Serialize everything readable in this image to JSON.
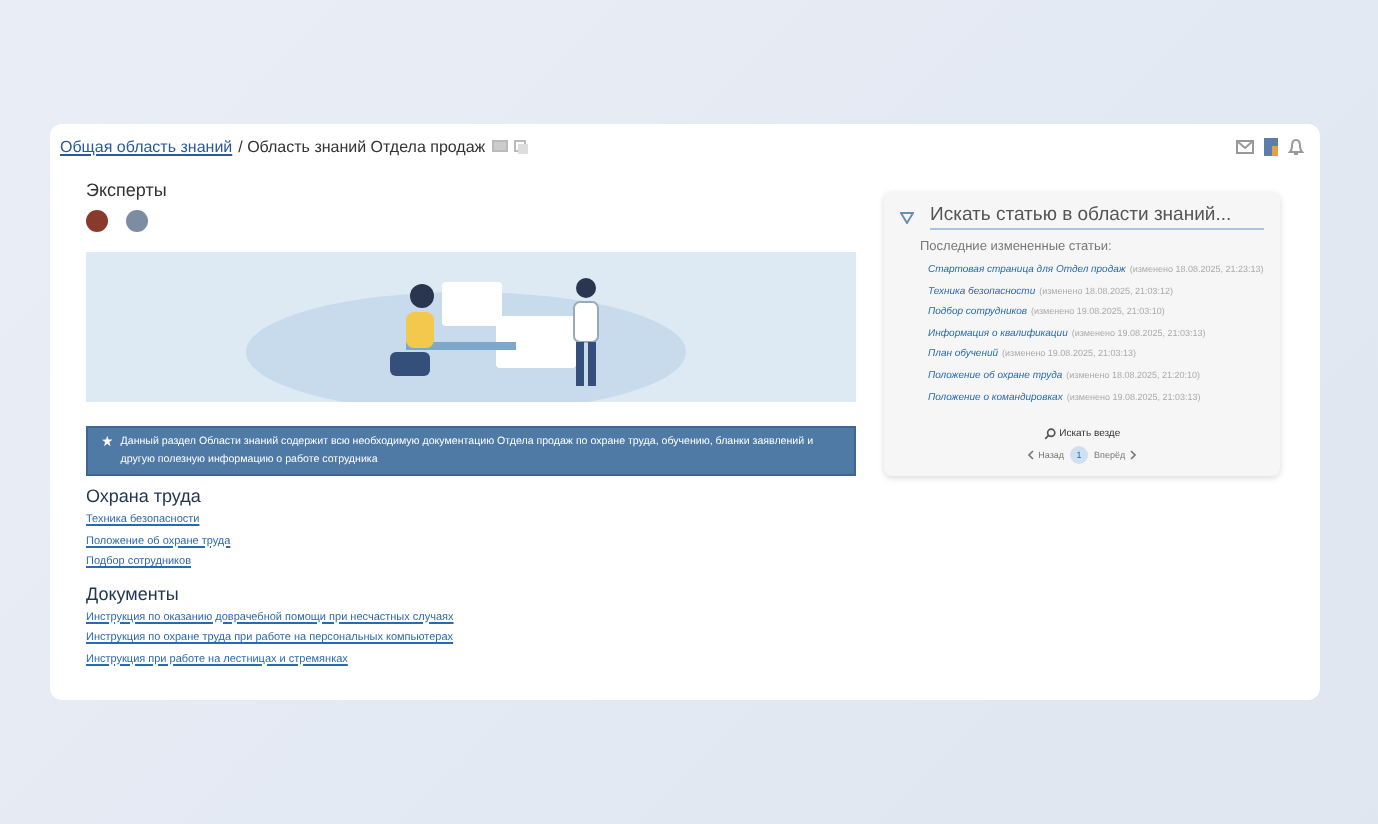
{
  "breadcrumb": {
    "link": "Общая область знаний",
    "current": "/ Область знаний Отдела продаж"
  },
  "experts": {
    "title": "Эксперты",
    "avatars": [
      {
        "color": "#8a3a2a"
      },
      {
        "color": "#7b8ca3"
      }
    ]
  },
  "notice": "Данный раздел Области знаний содержит всю необходимую документацию Отдела продаж по охране труда, обучению, бланки заявлений и другую полезную информацию о работе сотрудника",
  "sections": [
    {
      "title": "Охрана труда",
      "links": [
        "Техника безопасности",
        "Положение об охране труда",
        "Подбор сотрудников"
      ]
    },
    {
      "title": "Документы",
      "links": [
        "Инструкция по оказанию доврачебной помощи при несчастных случаях",
        "Инструкция по охране труда при работе на персональных компьютерах",
        "Инструкция при работе на лестницах и стремянках"
      ]
    }
  ],
  "search": {
    "placeholder": "Искать статью в области знаний..."
  },
  "recent": {
    "title": "Последние измененные статьи:",
    "items": [
      {
        "title": "Стартовая страница для Отдел продаж",
        "meta": "(изменено 18.08.2025, 21:23:13)"
      },
      {
        "title": "Техника безопасности",
        "meta": "(изменено 18.08.2025, 21:03:12)"
      },
      {
        "title": "Подбор сотрудников",
        "meta": "(изменено 19.08.2025, 21:03:10)"
      },
      {
        "title": "Информация о квалификации",
        "meta": "(изменено 19.08.2025, 21:03:13)"
      },
      {
        "title": "План обучений",
        "meta": "(изменено 19.08.2025, 21:03:13)"
      },
      {
        "title": "Положение об охране труда",
        "meta": "(изменено 18.08.2025, 21:20:10)"
      },
      {
        "title": "Положение о командировках",
        "meta": "(изменено 19.08.2025, 21:03:13)"
      }
    ]
  },
  "search_all": "Искать везде",
  "pagination": {
    "prev": "Назад",
    "next": "Вперёд",
    "pages": [
      {
        "label": "1",
        "selected": true
      }
    ]
  }
}
